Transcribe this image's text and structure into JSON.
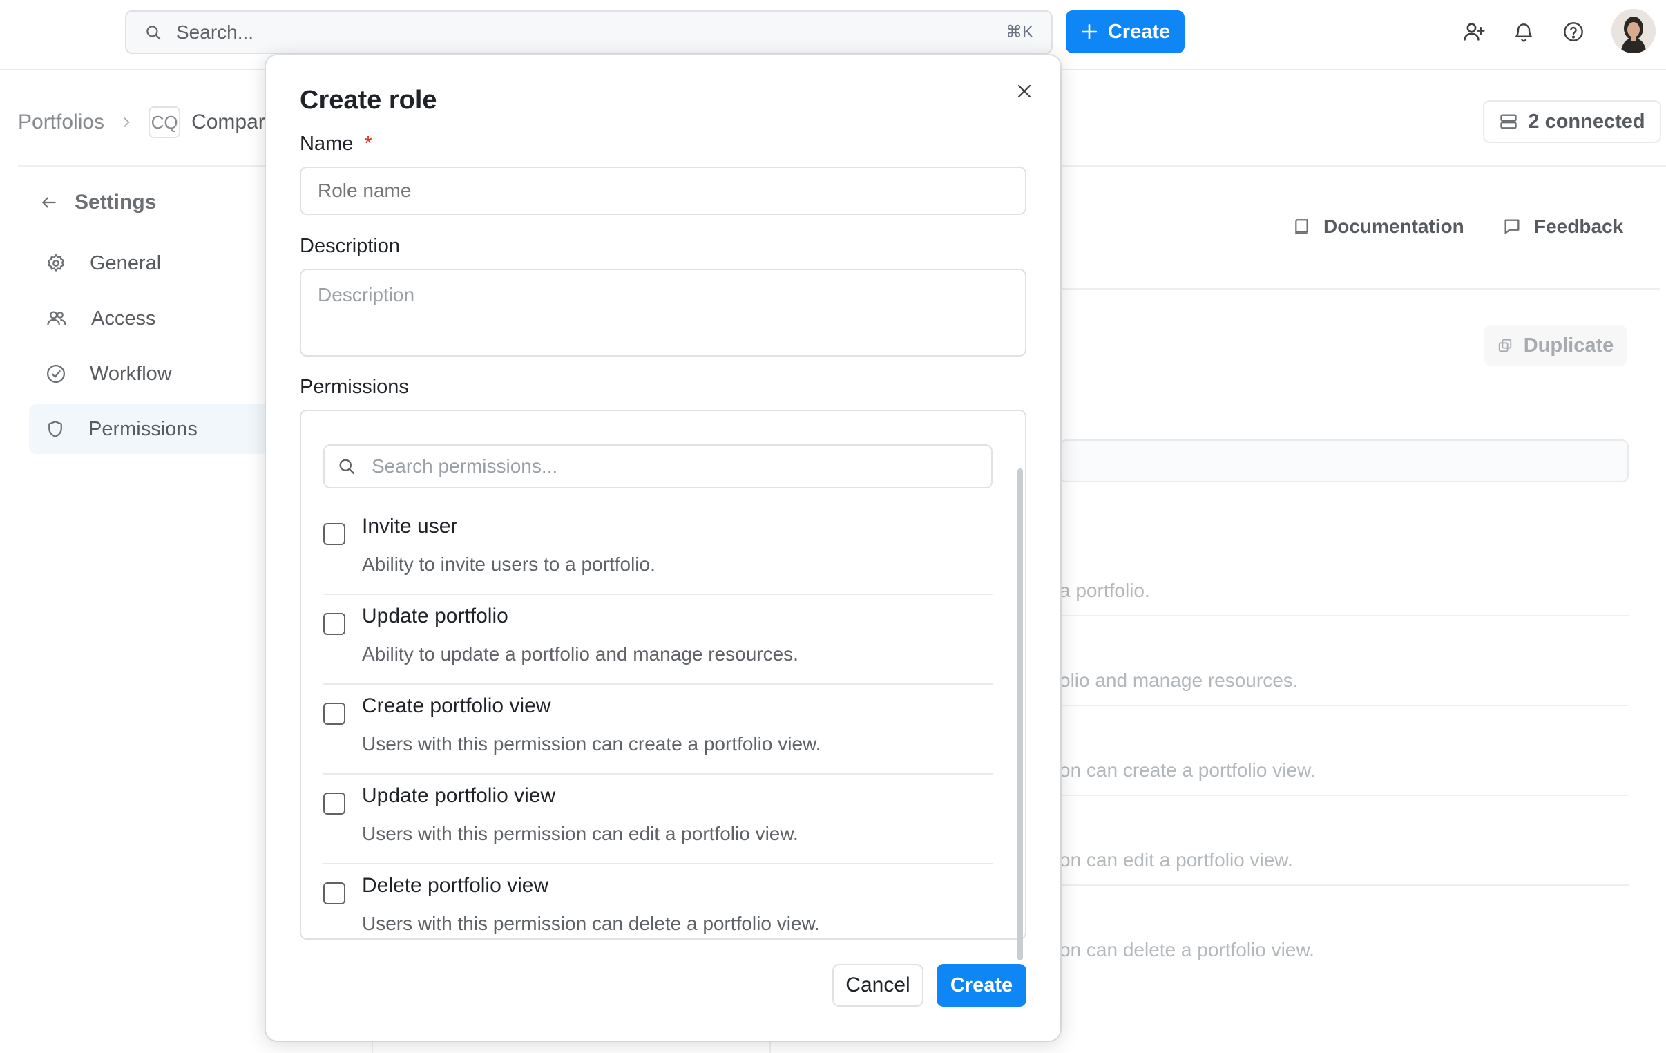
{
  "topbar": {
    "search_placeholder": "Search...",
    "search_shortcut": "⌘K",
    "create_label": "Create",
    "icons": [
      "search-icon",
      "plus-icon",
      "add-user-icon",
      "bell-icon",
      "help-icon"
    ]
  },
  "breadcrumb": {
    "root": "Portfolios",
    "badge": "CQ",
    "current": "Compar"
  },
  "connected_label": "2 connected",
  "sidebar": {
    "back_label": "Settings",
    "items": [
      {
        "label": "General",
        "icon": "gear-icon"
      },
      {
        "label": "Access",
        "icon": "users-icon"
      },
      {
        "label": "Workflow",
        "icon": "check-circle-icon"
      },
      {
        "label": "Permissions",
        "icon": "shield-icon",
        "active": true
      }
    ]
  },
  "header_links": {
    "documentation": "Documentation",
    "feedback": "Feedback"
  },
  "background": {
    "duplicate_label": "Duplicate",
    "rows": [
      "a portfolio.",
      "olio and manage resources.",
      "on can create a portfolio view.",
      "on can edit a portfolio view.",
      "on can delete a portfolio view."
    ]
  },
  "modal": {
    "title": "Create role",
    "name_label": "Name",
    "required_mark": "*",
    "name_placeholder": "Role name",
    "description_label": "Description",
    "description_placeholder": "Description",
    "permissions_label": "Permissions",
    "permissions_search_placeholder": "Search permissions...",
    "permissions": [
      {
        "title": "Invite user",
        "description": "Ability to invite users to a portfolio.",
        "checked": false
      },
      {
        "title": "Update portfolio",
        "description": "Ability to update a portfolio and manage resources.",
        "checked": false
      },
      {
        "title": "Create portfolio view",
        "description": "Users with this permission can create a portfolio view.",
        "checked": false
      },
      {
        "title": "Update portfolio view",
        "description": "Users with this permission can edit a portfolio view.",
        "checked": false
      },
      {
        "title": "Delete portfolio view",
        "description": "Users with this permission can delete a portfolio view.",
        "checked": false
      }
    ],
    "cancel_label": "Cancel",
    "create_label": "Create"
  },
  "colors": {
    "primary": "#0f86f5",
    "required": "#d93025",
    "active_nav_bg": "#eef4fb"
  }
}
